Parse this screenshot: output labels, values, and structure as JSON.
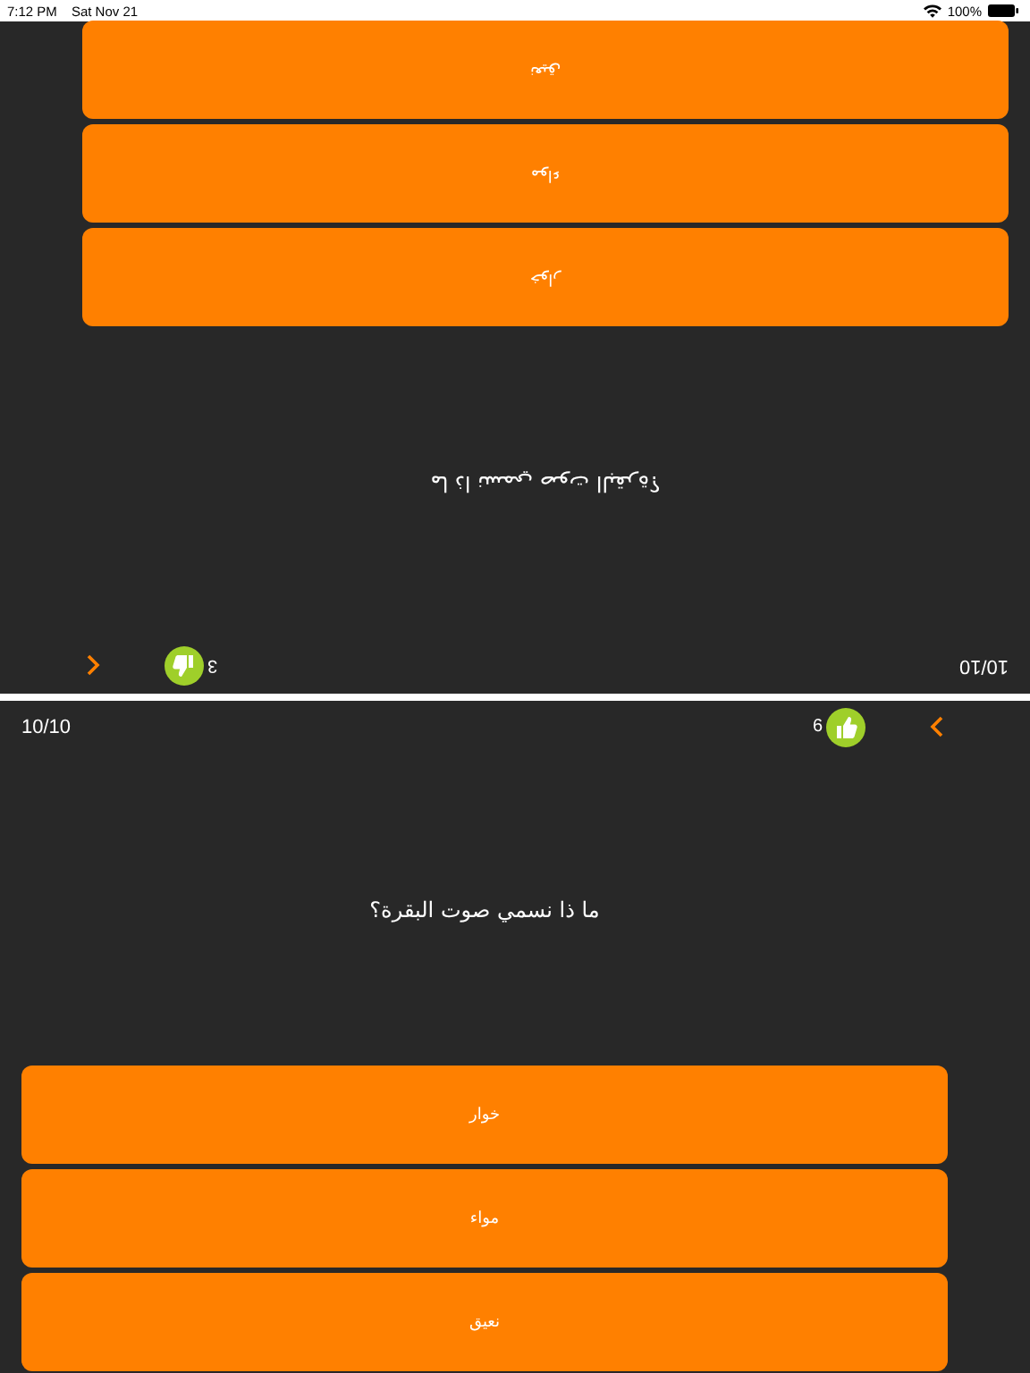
{
  "status_bar": {
    "time": "7:12 PM",
    "date": "Sat Nov 21",
    "battery": "100%"
  },
  "players": [
    {
      "flipped": true,
      "progress": "10/10",
      "score": "3",
      "question": "ما ذا نسمي صوت البقرة؟",
      "answers": [
        {
          "label": "خوار"
        },
        {
          "label": "مواء"
        },
        {
          "label": "نعيق"
        }
      ]
    },
    {
      "flipped": false,
      "progress": "10/10",
      "score": "6",
      "question": "ما ذا نسمي صوت البقرة؟",
      "answers": [
        {
          "label": "خوار"
        },
        {
          "label": "مواء"
        },
        {
          "label": "نعيق"
        }
      ]
    }
  ]
}
